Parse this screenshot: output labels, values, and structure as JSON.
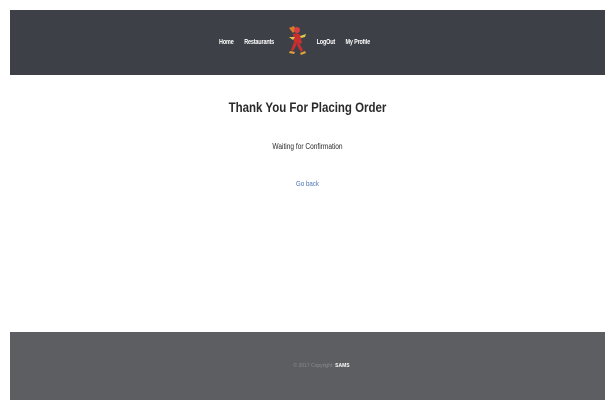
{
  "navbar": {
    "links": [
      "Home",
      "Restaurants",
      "LogOut",
      "My Profile"
    ]
  },
  "main": {
    "title": "Thank You For Placing Order",
    "subtitle": "Waiting for Confirmation",
    "go_back": "Go back"
  },
  "footer": {
    "copyright": "© 2017 Copyright:",
    "brand": "SAMS"
  },
  "colors": {
    "navbar_bg": "#3d4147",
    "footer_bg": "#5c5e61",
    "link": "#4a74b0"
  }
}
